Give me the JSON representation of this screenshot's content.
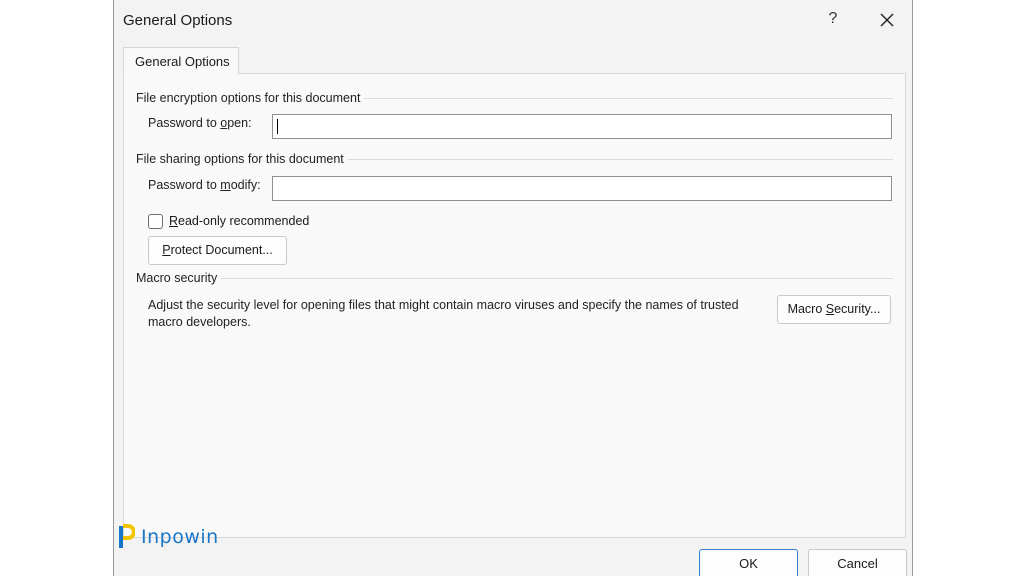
{
  "dialog": {
    "title": "General Options",
    "help_label": "?"
  },
  "tab": {
    "label": "General Options"
  },
  "encryption": {
    "section_label": "File encryption options for this document",
    "password_open_label_pre": "Password to ",
    "password_open_label_mnemonic": "o",
    "password_open_label_post": "pen:",
    "password_open_value": ""
  },
  "sharing": {
    "section_label": "File sharing options for this document",
    "password_modify_label_pre": "Password to ",
    "password_modify_label_mnemonic": "m",
    "password_modify_label_post": "odify:",
    "password_modify_value": "",
    "readonly_mnemonic": "R",
    "readonly_label_rest": "ead-only recommended",
    "readonly_checked": false,
    "protect_mnemonic": "P",
    "protect_label_rest": "rotect Document..."
  },
  "macro": {
    "section_label": "Macro security",
    "description": "Adjust the security level for opening files that might contain macro viruses and specify the names of trusted macro developers.",
    "button_pre": "Macro ",
    "button_mnemonic": "S",
    "button_post": "ecurity..."
  },
  "footer": {
    "ok_label": "OK",
    "cancel_label": "Cancel"
  },
  "watermark": {
    "text": "Inpowin"
  },
  "colors": {
    "accent": "#3c7fc6",
    "logo_yellow": "#f5c400",
    "logo_blue": "#1a76c8"
  }
}
